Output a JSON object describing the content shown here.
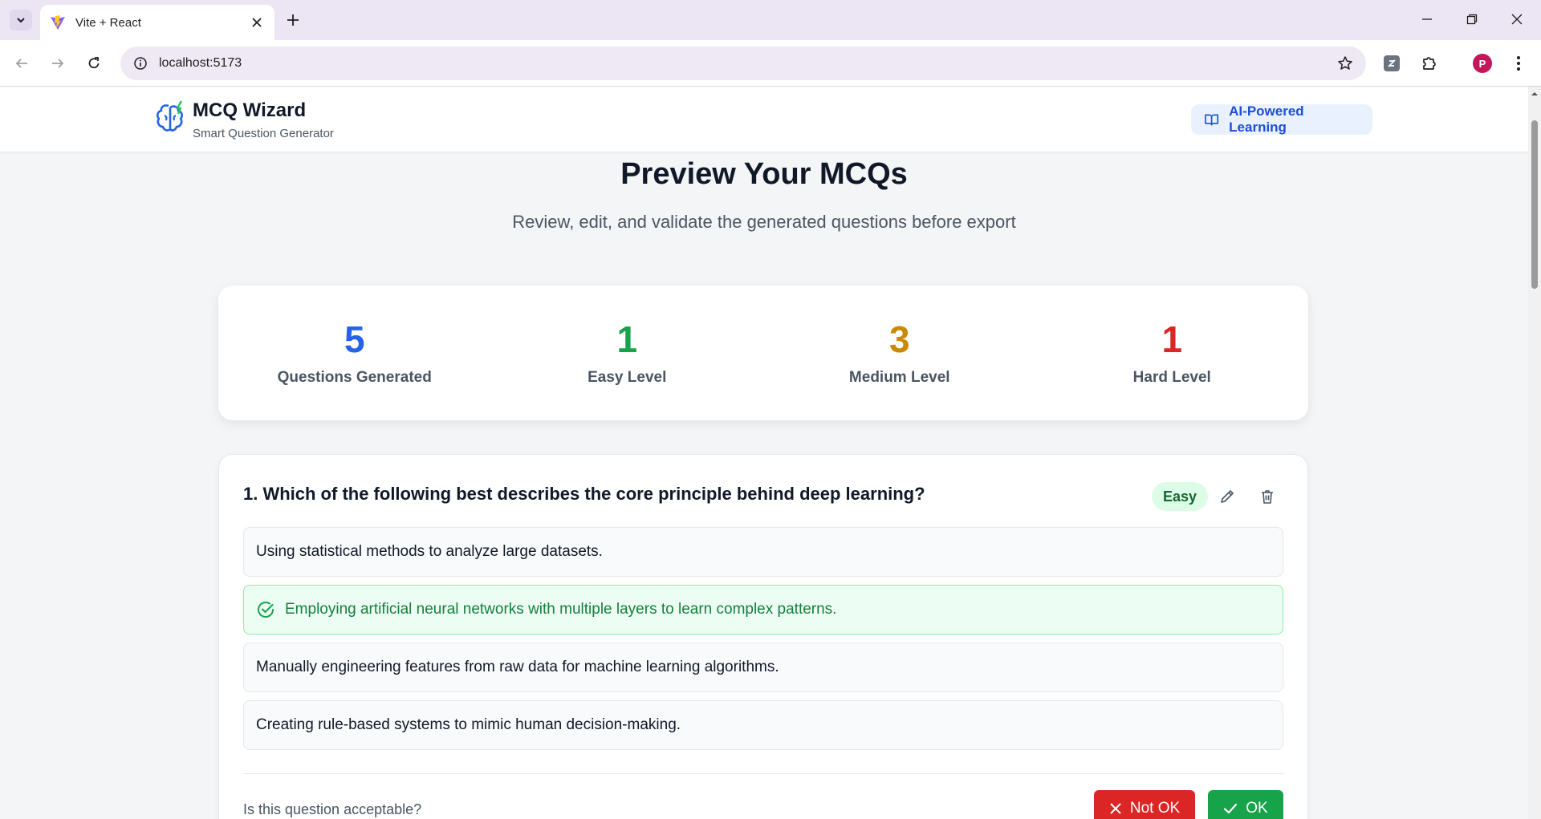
{
  "browser": {
    "tab_title": "Vite + React",
    "url": "localhost:5173",
    "profile_initial": "P"
  },
  "header": {
    "brand_name": "MCQ Wizard",
    "brand_sub": "Smart Question Generator",
    "badge": "AI-Powered Learning"
  },
  "page": {
    "title": "Preview Your MCQs",
    "subtitle": "Review, edit, and validate the generated questions before export"
  },
  "stats": [
    {
      "value": "5",
      "label": "Questions Generated",
      "color": "#2563eb"
    },
    {
      "value": "1",
      "label": "Easy Level",
      "color": "#16a34a"
    },
    {
      "value": "3",
      "label": "Medium Level",
      "color": "#ca8a04"
    },
    {
      "value": "1",
      "label": "Hard Level",
      "color": "#dc2626"
    }
  ],
  "question": {
    "title": "1. Which of the following best describes the core principle behind deep learning?",
    "difficulty": "Easy",
    "options": [
      {
        "text": "Using statistical methods to analyze large datasets.",
        "correct": false
      },
      {
        "text": "Employing artificial neural networks with multiple layers to learn complex patterns.",
        "correct": true
      },
      {
        "text": "Manually engineering features from raw data for machine learning algorithms.",
        "correct": false
      },
      {
        "text": "Creating rule-based systems to mimic human decision-making.",
        "correct": false
      }
    ],
    "accept_prompt": "Is this question acceptable?",
    "not_ok_label": "Not OK",
    "ok_label": "OK"
  }
}
